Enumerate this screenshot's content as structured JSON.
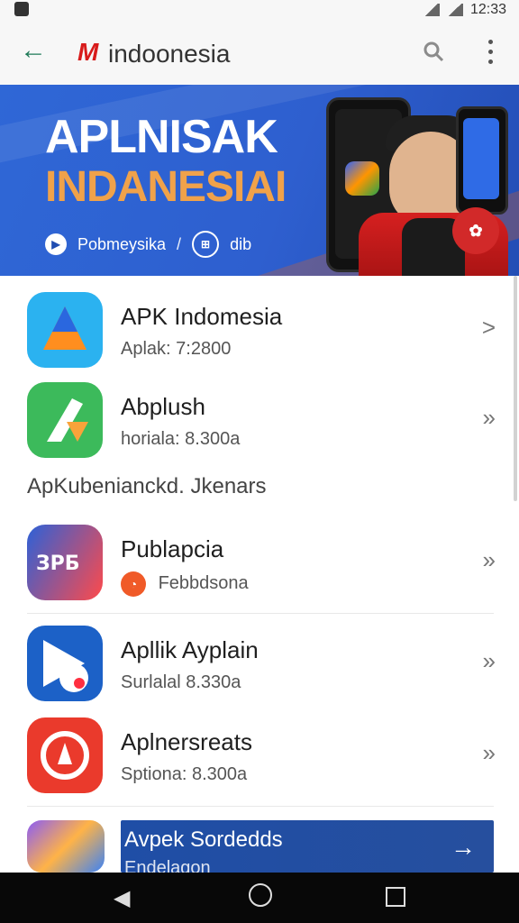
{
  "status": {
    "time": "12:33",
    "icons": [
      "notification-icon",
      "bluetooth-icon",
      "wifi-icon",
      "signal-icon",
      "battery-icon"
    ]
  },
  "appbar": {
    "brand_mark": "M",
    "title": "indoonesia"
  },
  "hero": {
    "title_line1": "APLNISAK",
    "title_line2": "INDANESIAI",
    "left_link": "Pobmeysika",
    "right_link": "dib"
  },
  "list": {
    "items": [
      {
        "title": "APK Indomesia",
        "subtitle": "Aplak: 7:2800",
        "chevron": ">",
        "icon_colors": [
          "#2bb2f0",
          "#ff8e1f",
          "#2a67df"
        ]
      },
      {
        "title": "Abplush",
        "subtitle": "horiala: 8.300a",
        "chevron": "»",
        "icon_colors": [
          "#3cba5b",
          "#f9a33a",
          "#ffffff"
        ]
      },
      {
        "section_title": "ApKubenianckd. Jkenars"
      },
      {
        "title": "Publapcia",
        "subtitle": "Febbdsona",
        "chevron": "»",
        "icon_colors": [
          "#2c61d8",
          "#ff4a4a",
          "#ffffff"
        ]
      },
      {
        "title": "Apllik Ayplain",
        "subtitle": "Surlalal 8.330a",
        "chevron": "»",
        "icon_colors": [
          "#1c61c7",
          "#ffffff",
          "#ff2f40"
        ]
      },
      {
        "title": "Aplnersreats",
        "subtitle": "Sptiona: 8.300a",
        "chevron": "»",
        "icon_colors": [
          "#ea3a2c",
          "#ffffff"
        ]
      }
    ],
    "banner": {
      "title": "Avpek Sordedds",
      "subtitle": "Endelagon"
    }
  },
  "navbar": {
    "back": "◀",
    "home": "",
    "recent": ""
  }
}
